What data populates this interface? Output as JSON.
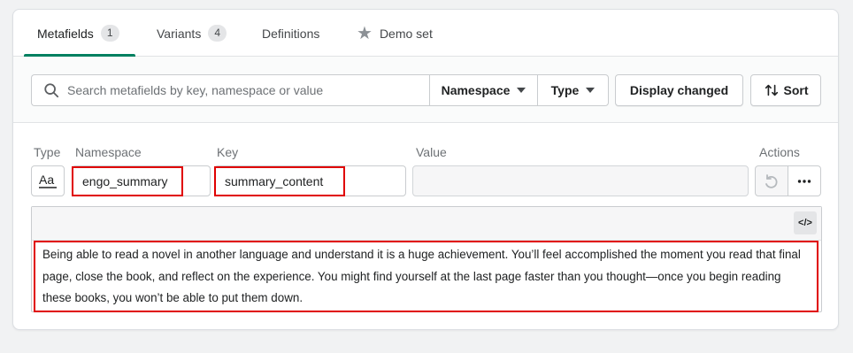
{
  "tabs": [
    {
      "label": "Metafields",
      "count": "1"
    },
    {
      "label": "Variants",
      "count": "4"
    },
    {
      "label": "Definitions"
    },
    {
      "label": "Demo set"
    }
  ],
  "toolbar": {
    "search_placeholder": "Search metafields by key, namespace or value",
    "namespace_label": "Namespace",
    "type_label": "Type",
    "display_changed_label": "Display changed",
    "sort_label": "Sort"
  },
  "columns": {
    "type": "Type",
    "namespace": "Namespace",
    "key": "Key",
    "value": "Value",
    "actions": "Actions"
  },
  "row": {
    "type_icon_text": "Aa",
    "namespace": "engo_summary",
    "key": "summary_content",
    "value": ""
  },
  "editor": {
    "code_toggle": "</>",
    "content": "Being able to read a novel in another language and understand it is a huge achievement. You’ll feel accomplished the moment you read that final page, close the book, and reflect on the experience. You might find yourself at the last page faster than you thought—once you begin reading these books, you won’t be able to put them down."
  },
  "colors": {
    "accent": "#008060",
    "highlight": "#e00000"
  }
}
